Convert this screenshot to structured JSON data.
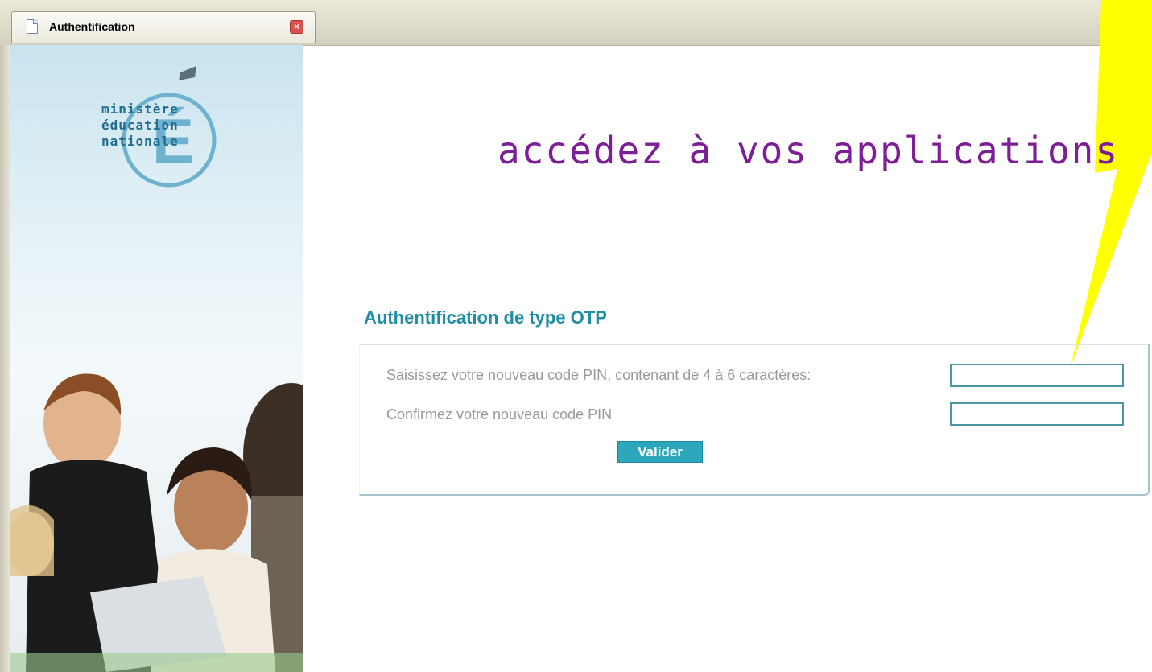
{
  "tab": {
    "title": "Authentification",
    "close_glyph": "×"
  },
  "logo": {
    "lines": [
      "ministère",
      "éducation",
      "nationale"
    ],
    "letter": "É"
  },
  "main": {
    "headline": "accédez à vos applications",
    "section_title": "Authentification de type OTP",
    "form": {
      "new_pin_label": "Saisissez votre nouveau code PIN, contenant de 4 à 6 caractères:",
      "new_pin_value": "",
      "confirm_pin_label": "Confirmez votre nouveau code PIN",
      "confirm_pin_value": "",
      "submit_label": "Valider"
    }
  },
  "colors": {
    "headline": "#7d1e96",
    "section_title": "#1f8ea4",
    "button": "#2ba6bb",
    "callout": "#ffff00"
  }
}
